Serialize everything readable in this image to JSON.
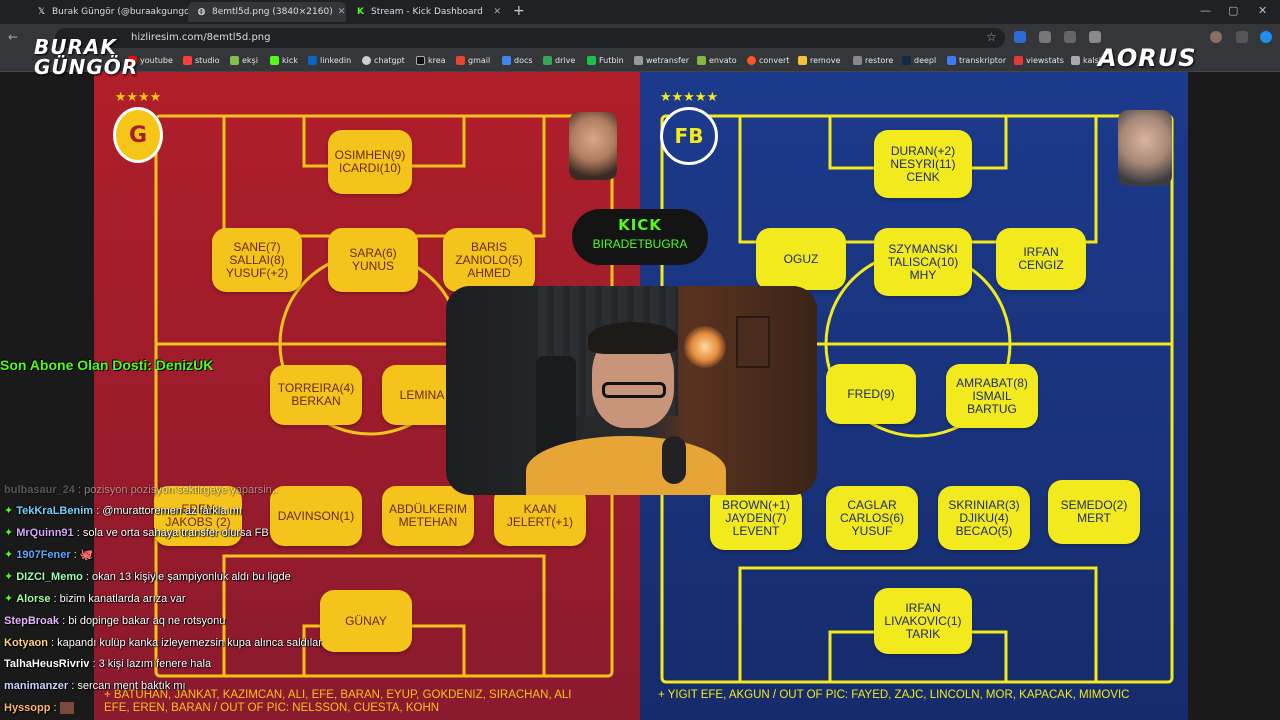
{
  "browser": {
    "tabs": [
      {
        "label": "Burak Güngör (@buraakgungor) / X",
        "icon": "x-logo-icon"
      },
      {
        "label": "8emtl5d.png (3840×2160)",
        "icon": "globe-icon"
      },
      {
        "label": "Stream - Kick Dashboard",
        "icon": "kick-logo-icon"
      }
    ],
    "address": "hizliresim.com/8emtl5d.png",
    "bookmarks": [
      "youtube",
      "studio",
      "ekşi",
      "kick",
      "linkedin",
      "chatgpt",
      "krea",
      "gmail",
      "docs",
      "drive",
      "Futbin",
      "wetransfer",
      "envato",
      "convert",
      "remove",
      "restore",
      "deepl",
      "transkriptor",
      "viewstats",
      "kalsir"
    ]
  },
  "overlay": {
    "watermark_left": "BURAK GÜNGÖR",
    "watermark_right": "AORUS",
    "kick_brand": "KICK",
    "kick_channel": "BIRADETBUGRA",
    "subscriber_alert": "Son Abone Olan Dosti: DenizUK"
  },
  "colors": {
    "gs_red": "#a81e2b",
    "gs_yellow": "#f4c31c",
    "fb_navy": "#1c3a8c",
    "fb_yellow": "#f3ea1d",
    "kick_green": "#53fc18"
  },
  "galatasaray": {
    "players": [
      "OSIMHEN(9)\nICARDI(10)",
      "SANE(7)\nSALLAI(8)\nYUSUF(+2)",
      "SARA(6)\nYUNUS",
      "BARIS\nZANIOLO(5)\nAHMED",
      "TORREIRA(4)\nBERKAN",
      "LEMINA",
      "EREN\nJAKOBS (2)",
      "DAVINSON(1)",
      "ABDÜLKERIM\nMETEHAN",
      "KAAN\nJELERT(+1)",
      "GÜNAY"
    ],
    "footnote": "+ BATUHAN, JANKAT, KAZIMCAN, ALI, EFE, BARAN, EYUP, GOKDENIZ, SIRACHAN, ALI\nEFE, EREN, BARAN / OUT OF PIC: NELSSON, CUESTA, KOHN"
  },
  "fenerbahce": {
    "players": [
      "DURAN(+2)\nNESYRI(11)\nCENK",
      "OGUZ",
      "SZYMANSKI\nTALISCA(10)\nMHY",
      "IRFAN\nCENGIZ",
      "FRED(9)",
      "AMRABAT(8)\nISMAIL\nBARTUG",
      "BROWN(+1)\nJAYDEN(7)\nLEVENT",
      "CAGLAR\nCARLOS(6)\nYUSUF",
      "SKRINIAR(3)\nDJIKU(4)\nBECAO(5)",
      "SEMEDO(2)\nMERT",
      "IRFAN\nLIVAKOVIC(1)\nTARIK"
    ],
    "footnote": "+ YIGIT EFE, AKGUN / OUT OF PIC: FAYED, ZAJC, LINCOLN, MOR, KAPACAK, MIMOVIC"
  },
  "chat": [
    {
      "user": "bulbasaur_24",
      "message": "pozisyon pozisyon sektirgeye yaparsin..",
      "user_color": "#9aa0a6",
      "faded": true,
      "badge": false
    },
    {
      "user": "TekKraLBenim",
      "message": "@murattoremen az farkla mı",
      "user_color": "#6fd3ff",
      "faded": false,
      "badge": true
    },
    {
      "user": "MrQuinn91",
      "message": "sola ve orta sahaya transfer olursa FB",
      "user_color": "#d7a6ff",
      "faded": false,
      "badge": true
    },
    {
      "user": "1907Fener",
      "message": "🐙",
      "user_color": "#5fa8ff",
      "faded": false,
      "badge": true
    },
    {
      "user": "DIZCI_Memo",
      "message": "okan 13 kişiyle şampiyonluk aldı bu ligde",
      "user_color": "#9fffb0",
      "faded": false,
      "badge": true
    },
    {
      "user": "Alorse",
      "message": "bizim kanatlarda arıza var",
      "user_color": "#a4ff9e",
      "faded": false,
      "badge": true
    },
    {
      "user": "StepBroak",
      "message": "bi dopinge bakar aq ne rotsyonu",
      "user_color": "#e8b7ff",
      "faded": false,
      "badge": false
    },
    {
      "user": "Kotyaon",
      "message": "kapandı kulüp kanka izleyemezsin kupa alınca saldılar",
      "user_color": "#ffd37a",
      "faded": false,
      "badge": false
    },
    {
      "user": "TalhaHeusRivriv",
      "message": "3 kişi lazım fenere hala",
      "user_color": "#ffffff",
      "faded": false,
      "badge": false
    },
    {
      "user": "manimanzer",
      "message": "sercan ment baktık mı",
      "user_color": "#c9d5ff",
      "faded": false,
      "badge": false
    },
    {
      "user": "Hyssopp",
      "message": "",
      "user_color": "#ffb86a",
      "faded": false,
      "badge": false
    }
  ]
}
